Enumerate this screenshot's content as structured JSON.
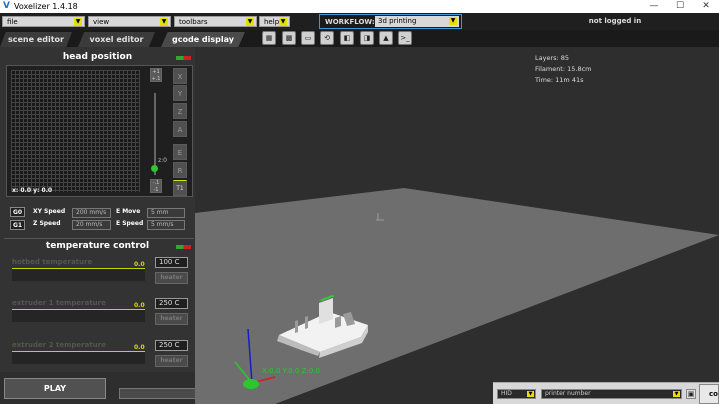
{
  "window": {
    "title": "Voxelizer 1.4.18",
    "app_icon": "V",
    "minimize": "—",
    "maximize": "☐",
    "close": "✕"
  },
  "menubar": {
    "menus": [
      {
        "label": "file"
      },
      {
        "label": "view"
      },
      {
        "label": "toolbars"
      },
      {
        "label": "help"
      }
    ],
    "workflow_label": "WORKFLOW:",
    "workflow_value": "3d printing",
    "login_status": "not logged in"
  },
  "tabs": [
    {
      "label": "scene editor"
    },
    {
      "label": "voxel editor"
    },
    {
      "label": "gcode display"
    }
  ],
  "toolbar_icons": [
    "stl-icon",
    "grid-icon",
    "code-icon",
    "rotate-icon",
    "slice-icon",
    "slice-alt-icon",
    "shape-icon",
    "terminal-icon"
  ],
  "head_position": {
    "title": "head position",
    "xy_readout": "x: 0.0 y: 0.0",
    "z_label": "z:0",
    "axes": [
      "X",
      "Y",
      "Z",
      "A",
      "E",
      "R"
    ],
    "step_up": "+1\n+.1",
    "step_down": "-.1\n-1",
    "home_btn": "T1",
    "g0": "G0",
    "g1": "G1",
    "xy_speed_label": "XY Speed",
    "xy_speed_value": "200 mm/s",
    "z_speed_label": "Z Speed",
    "z_speed_value": "20 mm/s",
    "e_move_label": "E Move",
    "e_move_value": "5 mm",
    "e_speed_label": "E Speed",
    "e_speed_value": "5 mm/s"
  },
  "temperature_control": {
    "title": "temperature control",
    "rows": [
      {
        "name": "hotbed temperature",
        "value": "0.0",
        "target": "100 C",
        "button": "heater"
      },
      {
        "name": "extruder 1 temperature",
        "value": "0.0",
        "target": "250 C",
        "button": "heater"
      },
      {
        "name": "extruder 2 temperature",
        "value": "0.0",
        "target": "250 C",
        "button": "heater"
      }
    ]
  },
  "play_label": "PLAY",
  "stats": {
    "layers": "Layers: 85",
    "filament": "Filament: 15.8cm",
    "time": "Time: 11m 41s"
  },
  "coords": "X:0.0 Y:0.0 Z:0.0",
  "bottom": {
    "hid": "HID",
    "printer_placeholder": "printer number",
    "connect": "co"
  },
  "colors": {
    "accent_yellow": "#e6e000",
    "temp_line": "#c8d400",
    "z_green": "#2ec62e",
    "workflow_border": "#3a9ad9"
  }
}
